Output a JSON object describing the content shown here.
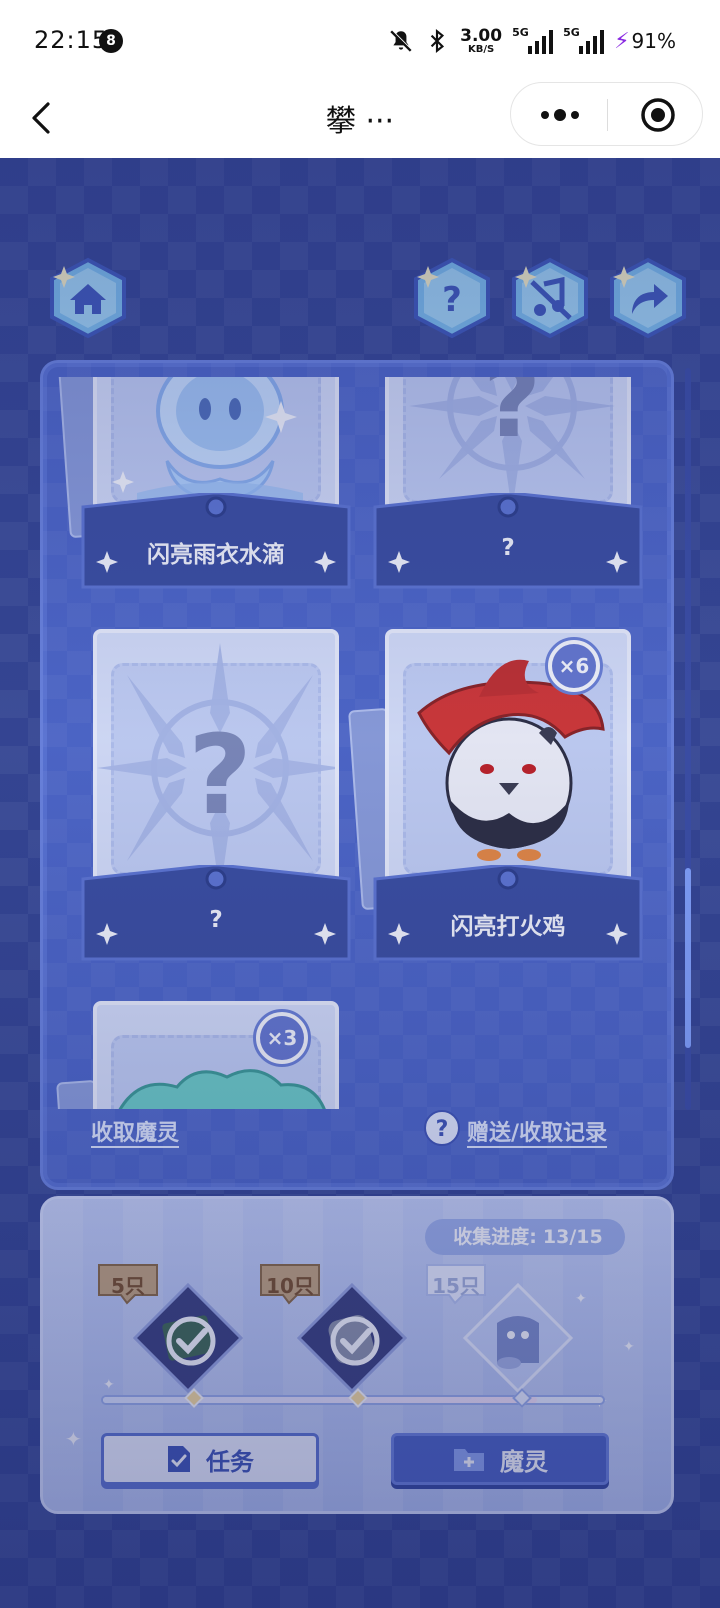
{
  "status_bar": {
    "time": "22:15",
    "notification_count": "8",
    "net_speed_value": "3.00",
    "net_speed_unit": "KB/S",
    "signal_1_label": "5G",
    "signal_2_label": "5G",
    "battery": "91%"
  },
  "nav": {
    "title": "攀 ···"
  },
  "top_buttons": {
    "home_icon": "home-icon",
    "help_icon": "question-icon",
    "mute_icon": "music-off-icon",
    "share_icon": "share-arrow-icon"
  },
  "cards": [
    {
      "name": "闪亮雨衣水滴",
      "known": true,
      "count": ""
    },
    {
      "name": "?",
      "known": false,
      "count": ""
    },
    {
      "name": "?",
      "known": false,
      "count": ""
    },
    {
      "name": "闪亮打火鸡",
      "known": true,
      "count": "×6"
    },
    {
      "name": "",
      "known": true,
      "count": "×3"
    }
  ],
  "panel_links": {
    "collect": "收取魔灵",
    "records": "赠送/收取记录"
  },
  "collection": {
    "label": "收集进度:",
    "progress": "13/15",
    "progress_fraction": 0.867,
    "milestones": [
      {
        "label": "5只",
        "claimed": true
      },
      {
        "label": "10只",
        "claimed": true
      },
      {
        "label": "15只",
        "claimed": false
      }
    ]
  },
  "bottom_buttons": {
    "task": "任务",
    "spirit": "魔灵"
  },
  "colors": {
    "game_bg": "#33438f",
    "panel_bg": "#4d66c7",
    "plate": "#3a4d9e",
    "accent_light": "#c6d2f6"
  }
}
